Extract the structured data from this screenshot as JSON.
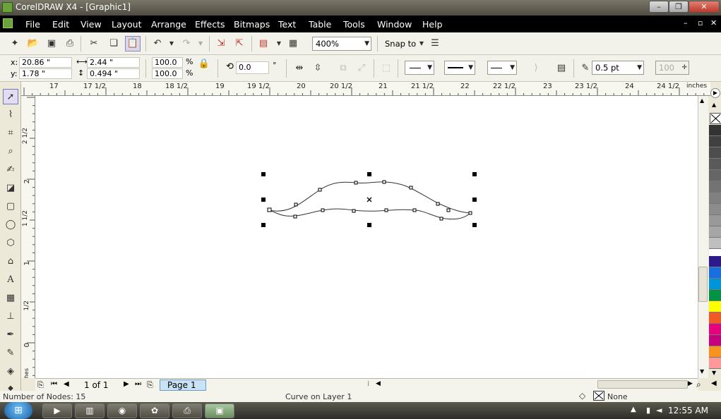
{
  "titlebar": {
    "title": "CorelDRAW X4 - [Graphic1]",
    "controls": [
      "–",
      "❐",
      "✕"
    ]
  },
  "menubar": {
    "items": [
      {
        "label": "File",
        "key": "F"
      },
      {
        "label": "Edit",
        "key": "E"
      },
      {
        "label": "View",
        "key": "V"
      },
      {
        "label": "Layout",
        "key": "L"
      },
      {
        "label": "Arrange",
        "key": "A"
      },
      {
        "label": "Effects",
        "key": "C"
      },
      {
        "label": "Bitmaps",
        "key": "B"
      },
      {
        "label": "Text",
        "key": "T"
      },
      {
        "label": "Table",
        "key": "T"
      },
      {
        "label": "Tools",
        "key": "O"
      },
      {
        "label": "Window",
        "key": "W"
      },
      {
        "label": "Help",
        "key": "H"
      }
    ],
    "doc_controls": [
      "–",
      "▫",
      "✕"
    ]
  },
  "toolbar": {
    "zoom_level": "400%",
    "snap_to": "Snap to",
    "icons": [
      "new-icon",
      "open-icon",
      "save-icon",
      "print-icon",
      "cut-icon",
      "copy-icon",
      "paste-icon",
      "undo-icon",
      "redo-icon",
      "import-icon",
      "export-icon",
      "app-launcher-icon",
      "welcome-icon",
      "options-icon"
    ]
  },
  "propbar": {
    "x_label": "x:",
    "x_value": "20.86 \"",
    "y_label": "y:",
    "y_value": "1.78 \"",
    "width_value": "2.44 \"",
    "height_value": "0.494 \"",
    "scale_x": "100.0",
    "scale_y": "100.0",
    "percent": "%",
    "angle": "0.0",
    "degree": "°",
    "outline_width": "0.5 pt",
    "opacity": "100"
  },
  "ruler": {
    "h_labels": [
      "17",
      "17 1/2",
      "18",
      "18 1/2",
      "19",
      "19 1/2",
      "20",
      "20 1/2",
      "21",
      "21 1/2",
      "22",
      "22 1/2",
      "23",
      "23 1/2",
      "24",
      "24 1/2"
    ],
    "h_unit": "inches",
    "v_labels": [
      "2 1/2",
      "2",
      "1 1/2",
      "1",
      "1/2",
      "0"
    ],
    "v_unit": "inches"
  },
  "pagebar": {
    "page_count": "1 of 1",
    "page_tab": "Page 1"
  },
  "status": {
    "nodes": "Number of Nodes: 15",
    "object": "Curve on Layer 1",
    "fill": "None"
  },
  "taskbar": {
    "time": "12:55 AM",
    "apps": [
      "app-icon-1",
      "app-icon-2",
      "app-icon-3",
      "app-icon-4",
      "app-icon-5",
      "app-icon-6"
    ]
  },
  "colors": {
    "palette": [
      "#333333",
      "#404040",
      "#4d4d4d",
      "#595959",
      "#666666",
      "#737373",
      "#808080",
      "#8c8c8c",
      "#999999",
      "#a6a6a6",
      "#b3b3b3",
      "#bfbfbf",
      "#cccccc",
      "#ffffff",
      "#2e1a8c",
      "#1a3fe0",
      "#0095d9",
      "#009245",
      "#00a651",
      "#ffff00",
      "#f7931e",
      "#e6007e",
      "#ff0000",
      "#c6007e",
      "#f15a24",
      "#ff9999"
    ]
  }
}
